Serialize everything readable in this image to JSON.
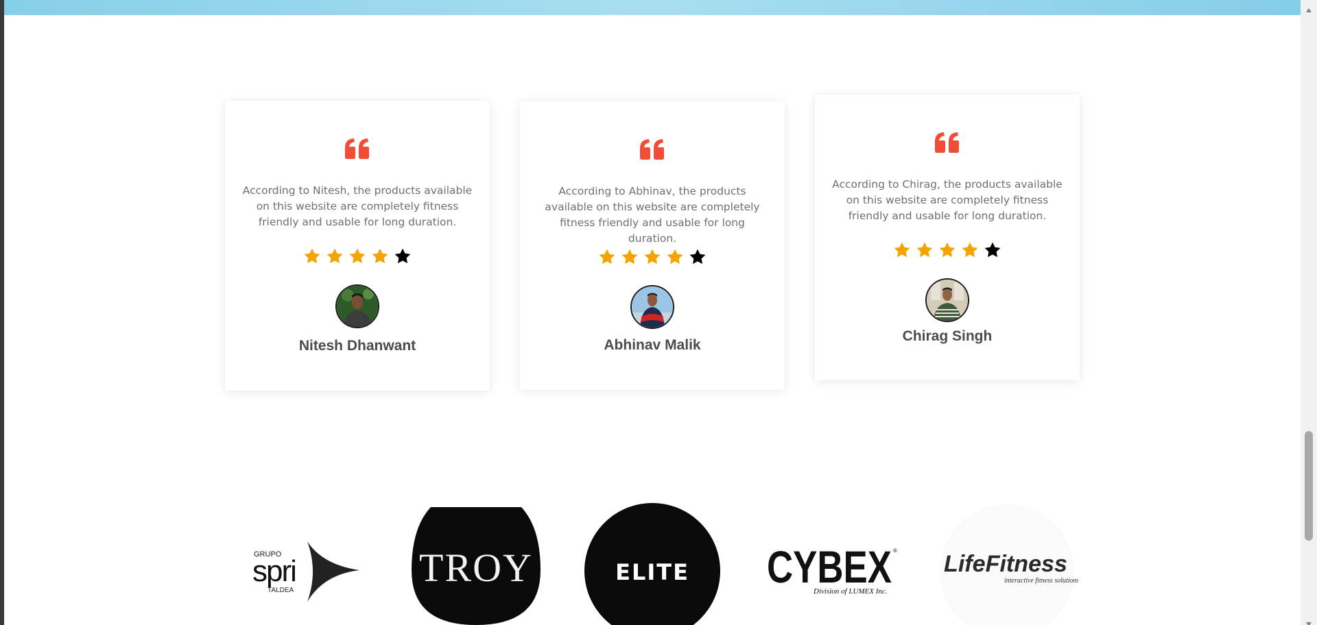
{
  "testimonials": [
    {
      "text": "According to Nitesh, the products available on this website are completely fitness friendly and usable for long duration.",
      "name": "Nitesh Dhanwant",
      "rating": 4,
      "max_rating": 5
    },
    {
      "text": "According to Abhinav, the products available on this website are completely fitness friendly and usable for long duration.",
      "name": "Abhinav Malik",
      "rating": 4,
      "max_rating": 5
    },
    {
      "text": "According to Chirag, the products available on this website are completely fitness friendly and usable for long duration.",
      "name": "Chirag Singh",
      "rating": 4,
      "max_rating": 5
    }
  ],
  "brands": {
    "spri": {
      "grupo": "GRUPO",
      "name": "spri",
      "sub": "TALDEA"
    },
    "troy": {
      "name": "TROY"
    },
    "elite": {
      "name": "ELITE"
    },
    "cybex": {
      "name": "CYBEX",
      "sub": "Division of LUMEX Inc.",
      "mark": "®"
    },
    "lifefitness": {
      "name": "LifeFitness",
      "sub": "interactive fitness solutions"
    }
  },
  "colors": {
    "quote": "#f04e37",
    "star_filled": "#f5a300",
    "star_empty": "#000000",
    "top_band": "#8fd3ec"
  },
  "icons": {
    "quote": "quote-icon",
    "star": "star-icon",
    "scroll_up": "arrow-up-icon",
    "scroll_down": "arrow-down-icon"
  }
}
